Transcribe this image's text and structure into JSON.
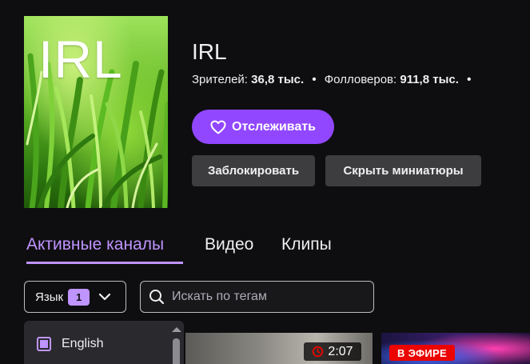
{
  "category": {
    "boxart_title": "IRL",
    "title": "IRL",
    "stats": {
      "viewers_label": "Зрителей:",
      "viewers_value": "36,8 тыс.",
      "separator": "•",
      "followers_label": "Фолловеров:",
      "followers_value": "911,8 тыс.",
      "separator2": "•"
    }
  },
  "actions": {
    "follow_label": "Отслеживать",
    "block_label": "Заблокировать",
    "hide_thumbnails_label": "Скрыть миниатюры"
  },
  "tabs": [
    {
      "label": "Активные каналы",
      "active": true
    },
    {
      "label": "Видео",
      "active": false
    },
    {
      "label": "Клипы",
      "active": false
    }
  ],
  "filters": {
    "language_label": "Язык",
    "language_count": "1",
    "tag_search_placeholder": "Искать по тегам"
  },
  "language_popup": {
    "options": [
      {
        "label": "English",
        "checked": true
      }
    ]
  },
  "cards": [
    {
      "duration": "2:07"
    },
    {
      "live_label": "В ЭФИРЕ"
    }
  ],
  "colors": {
    "accent": "#9147ff",
    "accent_light": "#bf94ff",
    "background": "#0e0e10",
    "button_gray": "#3d3d40",
    "live_red": "#eb0400"
  },
  "icons": {
    "follow": "heart-icon",
    "dropdown": "chevron-down-icon",
    "search": "search-icon",
    "duration": "clock-icon",
    "scroll": "scroll-up-icon"
  }
}
